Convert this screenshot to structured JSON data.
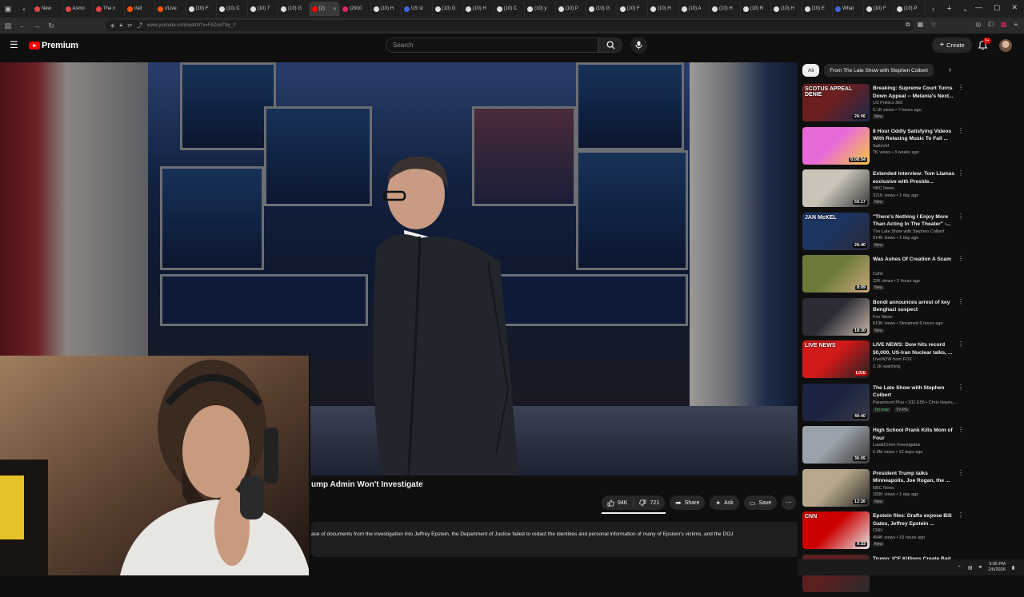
{
  "browser": {
    "tabs": [
      {
        "label": "New",
        "color": "#e04545"
      },
      {
        "label": "Asmo",
        "color": "#e04545"
      },
      {
        "label": "The n",
        "color": "#e04545"
      },
      {
        "label": "r/all",
        "color": "#ff5700"
      },
      {
        "label": "r/Live",
        "color": "#ff5700"
      },
      {
        "label": "(10) F",
        "color": "#dddddd"
      },
      {
        "label": "(10) C",
        "color": "#dddddd"
      },
      {
        "label": "(10) T",
        "color": "#dddddd"
      },
      {
        "label": "(10) G",
        "color": "#dddddd"
      },
      {
        "label": "(2)",
        "color": "#ff0000"
      },
      {
        "label": "(2910",
        "color": "#e0245e"
      },
      {
        "label": "(10) H",
        "color": "#dddddd"
      },
      {
        "label": "US st",
        "color": "#3b6ae0"
      },
      {
        "label": "(10) G",
        "color": "#dddddd"
      },
      {
        "label": "(10) H",
        "color": "#dddddd"
      },
      {
        "label": "(10) C",
        "color": "#dddddd"
      },
      {
        "label": "(10) y",
        "color": "#dddddd"
      },
      {
        "label": "(10) P",
        "color": "#dddddd"
      },
      {
        "label": "(10) G",
        "color": "#dddddd"
      },
      {
        "label": "(10) F",
        "color": "#dddddd"
      },
      {
        "label": "(10) H",
        "color": "#dddddd"
      },
      {
        "label": "(10) A",
        "color": "#dddddd"
      },
      {
        "label": "(10) H",
        "color": "#dddddd"
      },
      {
        "label": "(10) R",
        "color": "#dddddd"
      },
      {
        "label": "(10) H",
        "color": "#dddddd"
      },
      {
        "label": "(10) E",
        "color": "#dddddd"
      },
      {
        "label": "What",
        "color": "#3b6ae0"
      },
      {
        "label": "(10) F",
        "color": "#dddddd"
      },
      {
        "label": "(10) P",
        "color": "#dddddd"
      }
    ],
    "active_tab_index": 9,
    "url": "www.youtube.com/watch?v=F9Zrel7Ny_Y"
  },
  "masthead": {
    "logo_word": "Premium",
    "search_placeholder": "Search",
    "create_label": "Create",
    "notification_count": "9+"
  },
  "video": {
    "title": "ump Admin Won't Investigate",
    "likes": "94K",
    "dislikes": "721",
    "share_label": "Share",
    "ask_label": "Ask",
    "save_label": "Save",
    "description": "ase of documents from the investigation into Jeffrey Epstein, the Department of Justice failed to redact the identities and personal information of many of Epstein's victims, and the DOJ"
  },
  "filters": {
    "chips": [
      "All",
      "From The Late Show with Stephen Colbert"
    ],
    "active_index": 0
  },
  "related": [
    {
      "title": "Breaking: Supreme Court Turns Down Appeal -- Melania's Next...",
      "channel": "US Politics 360",
      "meta": "5.1K views • 7 hours ago",
      "badge": "New",
      "duration": "26:06",
      "thumb_text": "SCOTUS APPEAL DENIE",
      "c1": "#6b1f1f",
      "c2": "#1c2a4a"
    },
    {
      "title": "8 Hour Oddly Satisfying Videos With Relaxing Music To Fall ...",
      "channel": "SatisVid",
      "meta": "7K views • 3 weeks ago",
      "badge": "",
      "duration": "8:08:54",
      "thumb_text": "",
      "c1": "#e86ad9",
      "c2": "#f5c842"
    },
    {
      "title": "Extended interview: Tom Llamas exclusive with Preside...",
      "channel": "NBC News",
      "meta": "321K views • 1 day ago",
      "badge": "New",
      "duration": "50:17",
      "thumb_text": "",
      "c1": "#c9c3b8",
      "c2": "#3a3a3a"
    },
    {
      "title": "\"There's Nothing I Enjoy More Than Acting In The Theater\" -...",
      "channel": "The Late Show with Stephen Colbert",
      "meta": "514K views • 1 day ago",
      "badge": "New",
      "duration": "26:40",
      "thumb_text": "JAN McKEL",
      "c1": "#1c3460",
      "c2": "#2a2a3a"
    },
    {
      "title": "Was Ashes Of Creation A Scam",
      "channel": "Cohh",
      "meta": "22K views • 2 hours ago",
      "badge": "New",
      "duration": "8:09",
      "thumb_text": "",
      "c1": "#6a7a3a",
      "c2": "#c9a67a"
    },
    {
      "title": "Bondi announces arrest of key Benghazi suspect",
      "channel": "Fox News",
      "meta": "613K views • Streamed 6 hours ago",
      "badge": "New",
      "duration": "18:30",
      "thumb_text": "",
      "c1": "#2c2c36",
      "c2": "#c8b9a8"
    },
    {
      "title": "LIVE NEWS: Dow hits record 50,000, US-Iran Nuclear talks, ...",
      "channel": "LiveNOW from FOX",
      "meta": "2.1K watching",
      "badge": "",
      "duration": "LIVE",
      "thumb_text": "LIVE NEWS",
      "c1": "#d21a1a",
      "c2": "#222"
    },
    {
      "title": "The Late Show with Stephen Colbert",
      "channel": "Paramount Plus • S11 E56 • Chris Hayes,...",
      "meta": "",
      "badge": "Try now",
      "badge2": "TV-PG",
      "duration": "40:40",
      "thumb_text": "",
      "c1": "#1a2440",
      "c2": "#3a3a48"
    },
    {
      "title": "High School Prank Kills Mom of Four",
      "channel": "Law&Crime Investigates",
      "meta": "5.9M views • 12 days ago",
      "badge": "",
      "duration": "36:05",
      "thumb_text": "",
      "c1": "#9aa3ab",
      "c2": "#3a3a3a"
    },
    {
      "title": "President Trump talks Minneapolis, Joe Rogan, the ...",
      "channel": "NBC News",
      "meta": "183K views • 1 day ago",
      "badge": "New",
      "duration": "12:26",
      "thumb_text": "",
      "c1": "#b8a88a",
      "c2": "#2a2a2a"
    },
    {
      "title": "Epstein files: Drafts expose Bill Gates, Jeffrey Epstein ...",
      "channel": "CNN",
      "meta": "494K views • 19 hours ago",
      "badge": "New",
      "duration": "9:33",
      "thumb_text": "CNN",
      "c1": "#cc0000",
      "c2": "#e5e5e5"
    },
    {
      "title": "Trump: ICE Killings Create Bad",
      "channel": "",
      "meta": "",
      "badge": "",
      "duration": "",
      "thumb_text": "",
      "c1": "#5a2020",
      "c2": "#2a2a2a"
    }
  ],
  "taskbar": {
    "time": "3:35 PM",
    "date": "2/6/2026"
  },
  "colors": {
    "accent": "#ff0000",
    "background": "#0f0f0f",
    "chip": "#272727"
  }
}
